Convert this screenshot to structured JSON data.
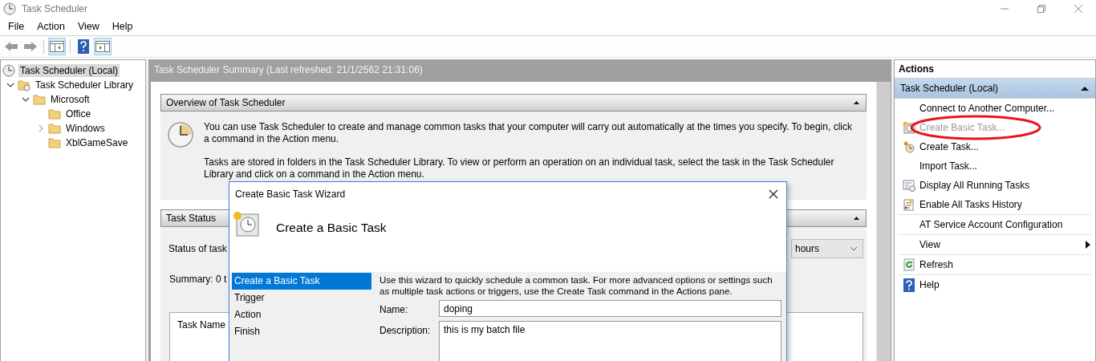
{
  "window": {
    "title": "Task Scheduler"
  },
  "menu": [
    "File",
    "Action",
    "View",
    "Help"
  ],
  "toolbar": [
    {
      "kind": "back",
      "pressed": false,
      "disabled": true
    },
    {
      "kind": "forward",
      "pressed": false,
      "disabled": true
    },
    {
      "kind": "tree",
      "pressed": true
    },
    {
      "kind": "help",
      "pressed": false
    },
    {
      "kind": "pane",
      "pressed": true
    }
  ],
  "tree": [
    {
      "label": "Task Scheduler (Local)",
      "kind": "clock",
      "selected": true,
      "children": [
        {
          "label": "Task Scheduler Library",
          "kind": "library",
          "selected": false,
          "expanded": true,
          "children": [
            {
              "label": "Microsoft",
              "kind": "folder",
              "selected": false,
              "expanded": true,
              "children": [
                {
                  "label": "Office",
                  "kind": "folder",
                  "selected": false
                },
                {
                  "label": "Windows",
                  "kind": "folder",
                  "selected": false,
                  "expanded": false
                },
                {
                  "label": "XblGameSave",
                  "kind": "folder",
                  "selected": false
                }
              ]
            }
          ]
        }
      ]
    }
  ],
  "summary": {
    "title": "Task Scheduler Summary (Last refreshed: 21/1/2562 21:31:06)",
    "overview": {
      "heading": "Overview of Task Scheduler",
      "expanded": true,
      "paragraphs": [
        "You can use Task Scheduler to create and manage common tasks that your computer will carry out automatically at the times you specify. To begin, click a command in the Action menu.",
        "Tasks are stored in folders in the Task Scheduler Library. To view or perform an operation on an individual task, select the task in the Task Scheduler Library and click on a command in the Action menu."
      ]
    },
    "task_status": {
      "heading": "Task Status",
      "expanded": true,
      "status_label": "Status of task",
      "period": "hours",
      "summary": "Summary: 0 t",
      "column_1": "Task Name"
    }
  },
  "dialog": {
    "title": "Create Basic Task Wizard",
    "heading": "Create a Basic Task",
    "steps": [
      {
        "label": "Create a Basic Task",
        "selected": true
      },
      {
        "label": "Trigger",
        "selected": false
      },
      {
        "label": "Action",
        "selected": false
      },
      {
        "label": "Finish",
        "selected": false
      }
    ],
    "intro": "Use this wizard to quickly schedule a common task.  For more advanced options or settings such as multiple task actions or triggers, use the Create Task command in the Actions pane.",
    "name_label": "Name:",
    "name_value": "doping",
    "description_label": "Description:",
    "description_value": "this is my batch file"
  },
  "actions": {
    "title": "Actions",
    "section": "Task Scheduler (Local)",
    "expanded": true,
    "items": [
      {
        "label": "Connect to Another Computer...",
        "kind": "plain",
        "disabled": false,
        "highlighted": false,
        "divider_above": false
      },
      {
        "label": "Create Basic Task...",
        "kind": "wizard",
        "disabled": true,
        "highlighted": true,
        "divider_above": false
      },
      {
        "label": "Create Task...",
        "kind": "task",
        "disabled": false,
        "highlighted": false,
        "divider_above": false
      },
      {
        "label": "Import Task...",
        "kind": "plain",
        "disabled": false,
        "highlighted": false,
        "divider_above": false
      },
      {
        "label": "Display All Running Tasks",
        "kind": "running",
        "disabled": false,
        "highlighted": false,
        "divider_above": false
      },
      {
        "label": "Enable All Tasks History",
        "kind": "history",
        "disabled": false,
        "highlighted": false,
        "divider_above": false
      },
      {
        "label": "AT Service Account Configuration",
        "kind": "plain",
        "disabled": false,
        "highlighted": false,
        "divider_above": true
      },
      {
        "label": "View",
        "kind": "submenu",
        "disabled": false,
        "highlighted": false,
        "divider_above": true
      },
      {
        "label": "Refresh",
        "kind": "refresh",
        "disabled": false,
        "highlighted": false,
        "divider_above": true
      },
      {
        "label": "Help",
        "kind": "help",
        "disabled": false,
        "highlighted": false,
        "divider_above": true
      }
    ]
  }
}
